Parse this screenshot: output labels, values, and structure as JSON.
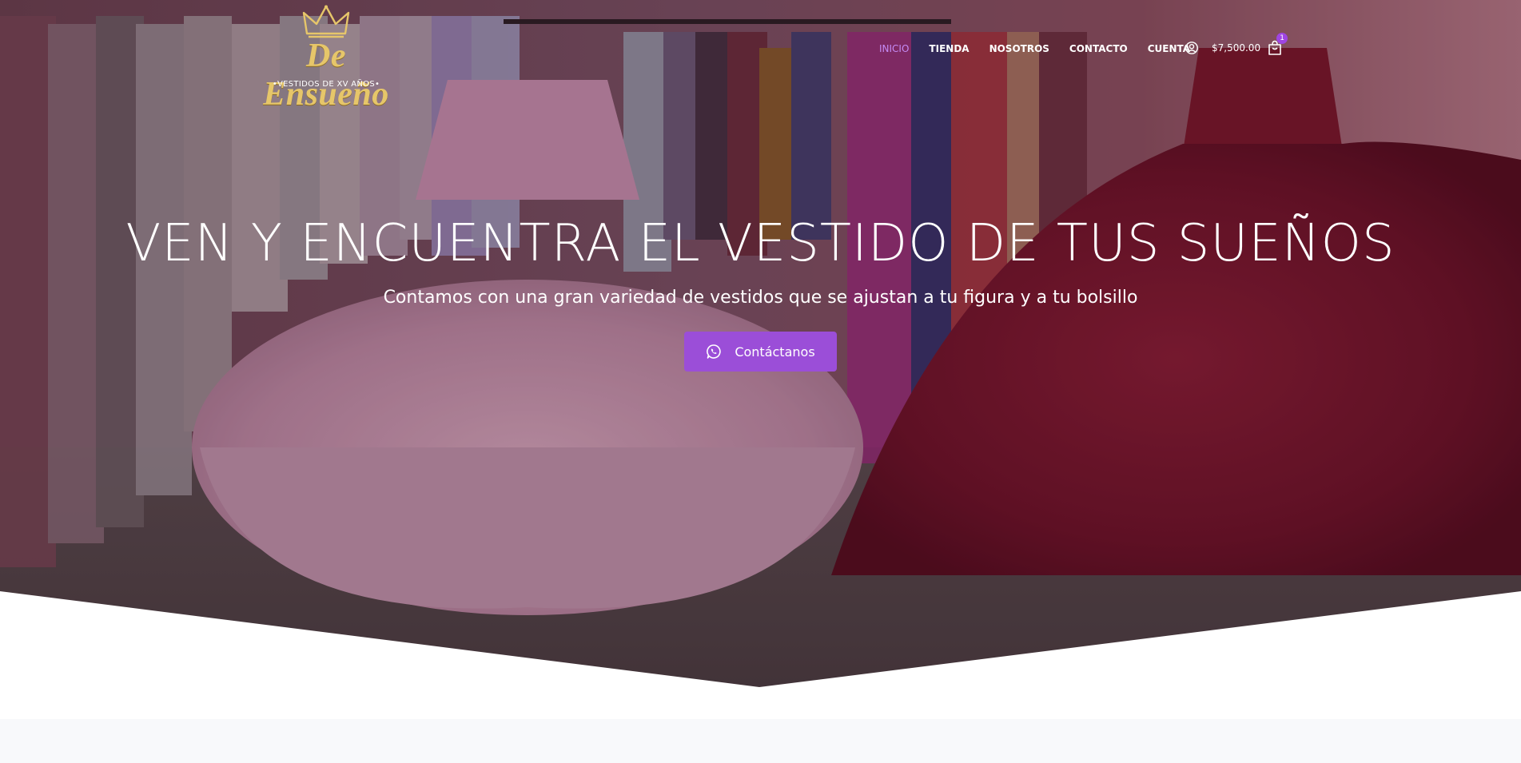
{
  "brand": {
    "name": "De Ensueño",
    "tagline": "•VESTIDOS DE XV AÑOS•"
  },
  "nav": {
    "items": [
      {
        "label": "INICIO",
        "active": true
      },
      {
        "label": "TIENDA",
        "active": false
      },
      {
        "label": "NOSOTROS",
        "active": false
      },
      {
        "label": "CONTACTO",
        "active": false
      },
      {
        "label": "CUENTA",
        "active": false
      }
    ]
  },
  "header": {
    "account_icon": "user-circle-icon",
    "cart_total": "$7,500.00",
    "cart_icon": "shopping-bag-icon",
    "cart_count": "1"
  },
  "hero": {
    "title": "VEN Y ENCUENTRA EL VESTIDO DE TUS SUEÑOS",
    "subtitle": "Contamos con una gran variedad de vestidos que se ajustan a tu figura y a tu bolsillo",
    "cta_label": "Contáctanos",
    "cta_icon": "whatsapp-icon"
  },
  "colors": {
    "accent": "#9b4ed8",
    "active_nav": "#c48bf5",
    "badge": "#9f45e3",
    "logo_gold": "#e6c66a",
    "overlay": "#3a2330"
  }
}
